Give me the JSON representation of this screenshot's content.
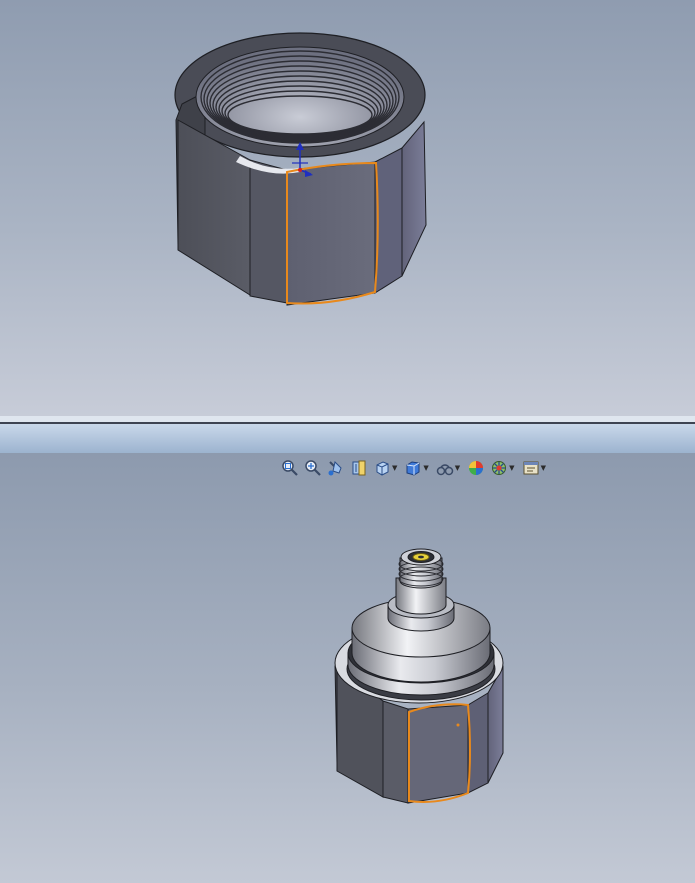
{
  "icons": {
    "zoom_fit": "zoom-to-fit-icon",
    "zoom_area": "zoom-to-area-icon",
    "previous_view": "previous-view-icon",
    "section_view": "section-view-icon",
    "view_orientation": "view-orientation-icon",
    "display_style": "display-style-icon",
    "hide_show": "hide-show-items-icon",
    "edit_appearance": "edit-appearance-icon",
    "apply_scene": "apply-scene-icon",
    "view_settings": "view-settings-icon"
  },
  "colors": {
    "selection": "#e8891c",
    "triad": "#1f2fbf",
    "viewport_top": "#8f9cb0",
    "viewport_bottom": "#c7ccd8"
  }
}
